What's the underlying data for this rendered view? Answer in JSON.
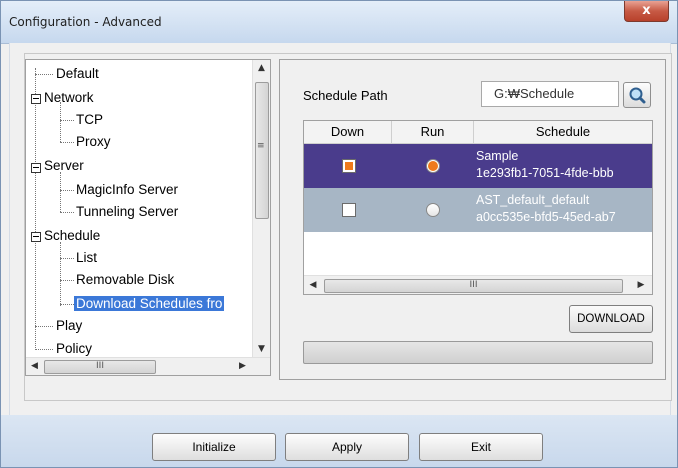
{
  "window": {
    "title": "Configuration - Advanced",
    "close_label": "x"
  },
  "tree": {
    "items": [
      {
        "label": "Default"
      },
      {
        "label": "Network"
      },
      {
        "label": "TCP"
      },
      {
        "label": "Proxy"
      },
      {
        "label": "Server"
      },
      {
        "label": "MagicInfo Server"
      },
      {
        "label": "Tunneling Server"
      },
      {
        "label": "Schedule"
      },
      {
        "label": "List"
      },
      {
        "label": "Removable Disk"
      },
      {
        "label": "Download Schedules fro"
      },
      {
        "label": "Play"
      },
      {
        "label": "Policy"
      }
    ],
    "selected": "Download Schedules fro",
    "hscroll_thumb_glyph": "III",
    "vscroll_up": "▲",
    "vscroll_down": "▼",
    "vscroll_grip": "≡",
    "hscroll_left": "◀",
    "hscroll_right": "▶"
  },
  "schedule": {
    "path_label": "Schedule Path",
    "path_value": "G:₩Schedule",
    "search_icon": "magnifier-icon",
    "columns": [
      "Down",
      "Run",
      "Schedule"
    ],
    "rows": [
      {
        "down": true,
        "run": true,
        "line1": "Sample",
        "line2": "1e293fb1-7051-4fde-bbb"
      },
      {
        "down": false,
        "run": false,
        "line1": "AST_default_default",
        "line2": "a0cc535e-bfd5-45ed-ab7"
      }
    ],
    "hscroll_thumb_glyph": "III",
    "hscroll_left": "◀",
    "hscroll_right": "▶",
    "download_label": "DOWNLOAD",
    "progress": 0
  },
  "footer": {
    "initialize_label": "Initialize",
    "apply_label": "Apply",
    "exit_label": "Exit"
  },
  "colors": {
    "selected_row": "#4a3c8c",
    "second_row": "#a7b6c5",
    "accent_orange": "#ef7a1a",
    "tree_selection": "#3b78d8"
  }
}
